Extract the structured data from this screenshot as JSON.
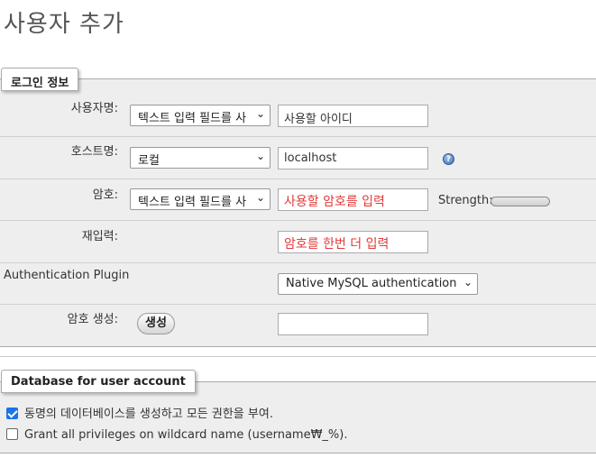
{
  "page": {
    "title": "사용자 추가"
  },
  "login": {
    "legend": "로그인 정보",
    "username": {
      "label": "사용자명:",
      "select_value": "텍스트 입력 필드를 사",
      "input_placeholder": "사용할 아이디"
    },
    "host": {
      "label": "호스트명:",
      "select_value": "로컬",
      "input_value": "localhost"
    },
    "password": {
      "label": "암호:",
      "select_value": "텍스트 입력 필드를 사",
      "input_placeholder": "사용할 암호를 입력",
      "strength_label": "Strength:"
    },
    "retype": {
      "label": "재입력:",
      "input_placeholder": "암호를 한번 더 입력"
    },
    "auth": {
      "label": "Authentication Plugin",
      "select_value": "Native MySQL authentication"
    },
    "generate": {
      "label": "암호 생성:",
      "button": "생성",
      "input_value": ""
    }
  },
  "database": {
    "legend": "Database for user account",
    "options": [
      {
        "label": "동명의 데이터베이스를 생성하고 모든 권한을 부여.",
        "checked": true
      },
      {
        "label": "Grant all privileges on wildcard name (username₩_%).",
        "checked": false
      }
    ]
  },
  "icons": {
    "dropdown": "chevron-down-icon",
    "help": "help-icon"
  },
  "colors": {
    "placeholder_red": "#e23a3a",
    "checkbox_accent": "#1a73e8",
    "fieldset_bg": "#eeeeee"
  }
}
